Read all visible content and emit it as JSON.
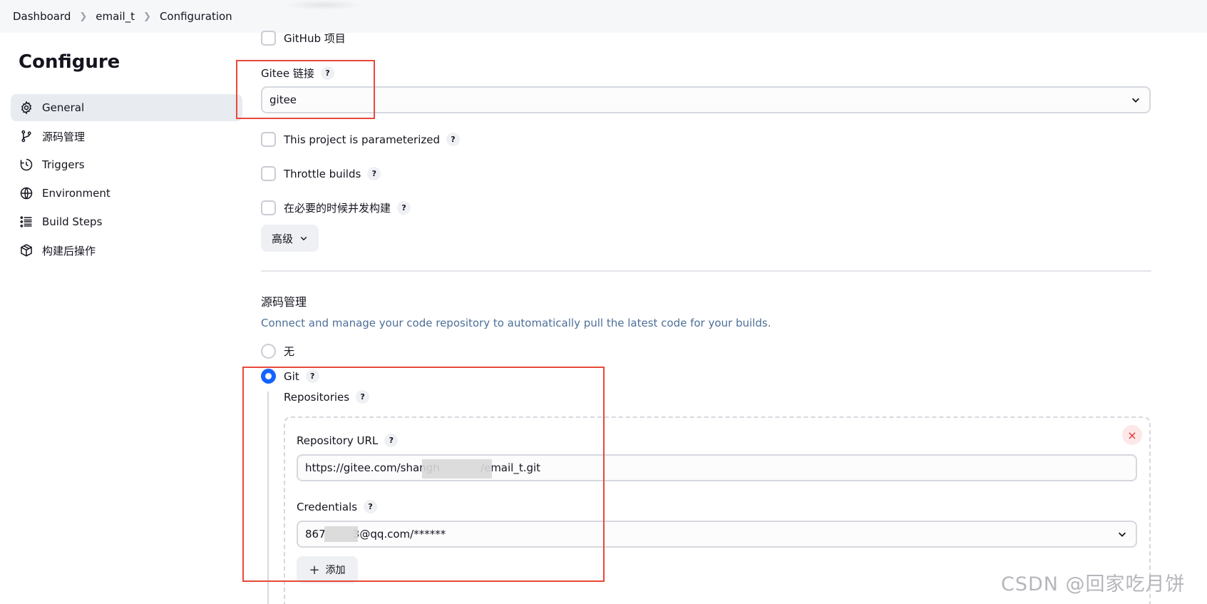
{
  "breadcrumb": {
    "items": [
      "Dashboard",
      "email_t",
      "Configuration"
    ]
  },
  "page_title": "Configure",
  "sidebar": {
    "items": [
      {
        "label": "General",
        "icon": "gear-icon",
        "active": true
      },
      {
        "label": "源码管理",
        "icon": "branch-icon"
      },
      {
        "label": "Triggers",
        "icon": "clock-icon"
      },
      {
        "label": "Environment",
        "icon": "globe-icon"
      },
      {
        "label": "Build Steps",
        "icon": "list-icon"
      },
      {
        "label": "构建后操作",
        "icon": "box-icon"
      }
    ]
  },
  "general": {
    "github_project_label": "GitHub 项目",
    "gitee_link_label": "Gitee 链接",
    "gitee_link_value": "gitee",
    "parameterized_label": "This project is parameterized",
    "throttle_label": "Throttle builds",
    "concurrent_label": "在必要的时候并发构建",
    "advanced_label": "高级"
  },
  "scm": {
    "title": "源码管理",
    "description": "Connect and manage your code repository to automatically pull the latest code for your builds.",
    "option_none": "无",
    "option_git": "Git",
    "repositories_label": "Repositories",
    "repo_url_label": "Repository URL",
    "repo_url_value": "https://gitee.com/shangh            /email_t.git",
    "credentials_label": "Credentials",
    "credentials_value": "867        3@qq.com/******",
    "add_label": "添加",
    "delete_symbol": "×"
  },
  "help_symbol": "?",
  "watermark": "CSDN @回家吃月饼",
  "colors": {
    "accent": "#1463ff",
    "annotation": "#e8493a",
    "description": "#4d6f98"
  }
}
